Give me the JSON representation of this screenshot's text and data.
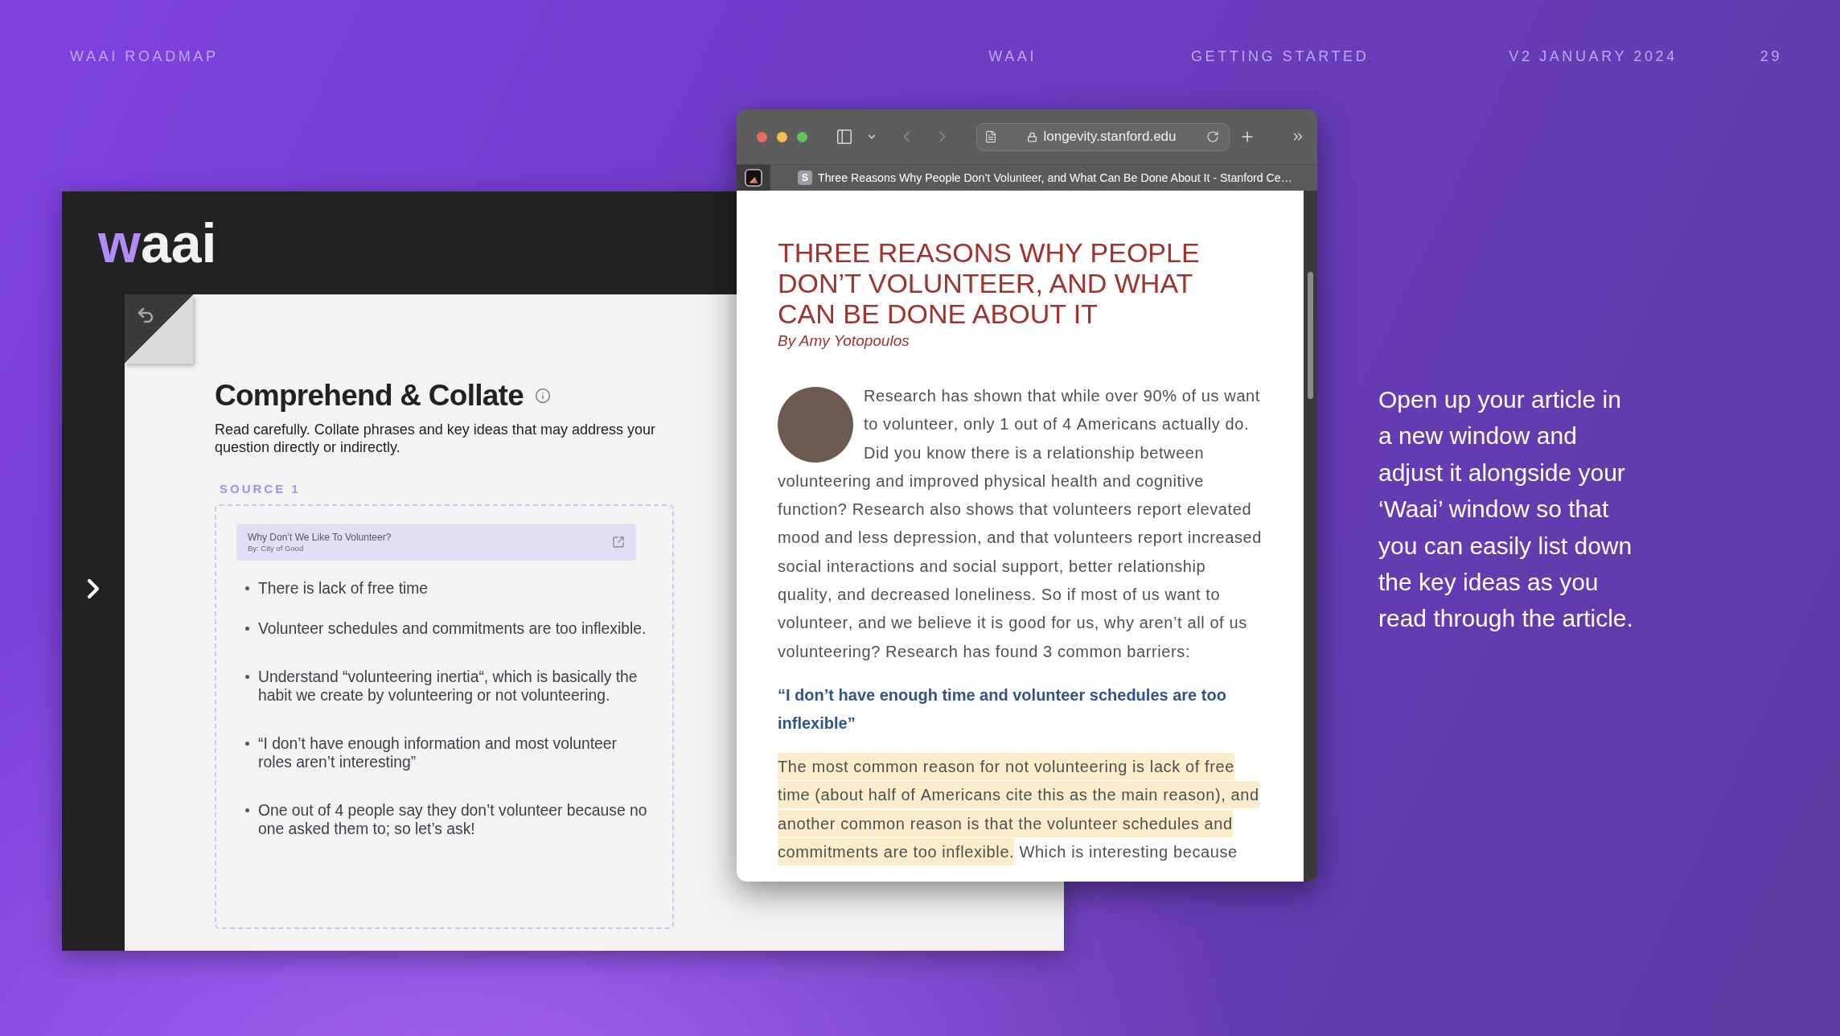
{
  "slide_header": {
    "title": "WAAI ROADMAP",
    "links": [
      "WAAI",
      "GETTING STARTED",
      "V2 JANUARY 2024"
    ],
    "page_number": "29"
  },
  "waai_app": {
    "logo": {
      "accent": "w",
      "text": "aai"
    },
    "title": "Comprehend & Collate",
    "instructions": "Read carefully. Collate phrases and key ideas that may address your question directly or indirectly.",
    "source": {
      "label": "SOURCE 1",
      "card": {
        "title": "Why Don’t We Like To Volunteer?",
        "byline": "By: City of Good"
      },
      "key_ideas": [
        "There is lack of free time",
        "Volunteer schedules and commitments are too inflexible.",
        "Understand “volunteering inertia“, which is basically the habit we create by volunteering or not volunteering.",
        "“I don’t have enough information and most volunteer roles aren’t interesting”",
        "One out of 4 people say they don’t volunteer because no one asked them to; so let’s ask!"
      ]
    }
  },
  "browser": {
    "url": "longevity.stanford.edu",
    "tab": {
      "favicon": "S",
      "title": "Three Reasons Why People Don’t Volunteer, and What Can Be Done About It - Stanford Ce…"
    },
    "article": {
      "title": "THREE REASONS WHY PEOPLE DON’T VOLUNTEER, AND WHAT CAN BE DONE ABOUT IT",
      "byline": "By Amy Yotopoulos",
      "intro": {
        "beside_photo": "Research has shown that while over 90% of us want to volunteer, only 1 out of 4 Americans actually do. Did you know there is a relationship between",
        "continued": "volunteering and improved physical health and cognitive function? Research also shows that volunteers report elevated mood and less depression, and that volunteers report increased social interactions and social support, better relationship quality, and decreased loneliness. So if most of us want to volunteer, and we believe it is good for us, why aren’t all of us volunteering? Research has found 3 common barriers:"
      },
      "subheading": "“I don’t have enough time and volunteer schedules are too inflexible”",
      "paragraph": [
        {
          "text": "The most common reason for not volunteering is lack of free time (about half of Americans cite this as the main reason), and another common reason is that the volunteer schedules and commitments are too inflexible.",
          "highlighted": true
        },
        {
          "text": " Which is interesting because",
          "highlighted": false
        }
      ]
    }
  },
  "caption": "Open up your article in a new window and adjust it alongside your ‘Waai’ window so that you can easily list down the key ideas as you read through the article."
}
